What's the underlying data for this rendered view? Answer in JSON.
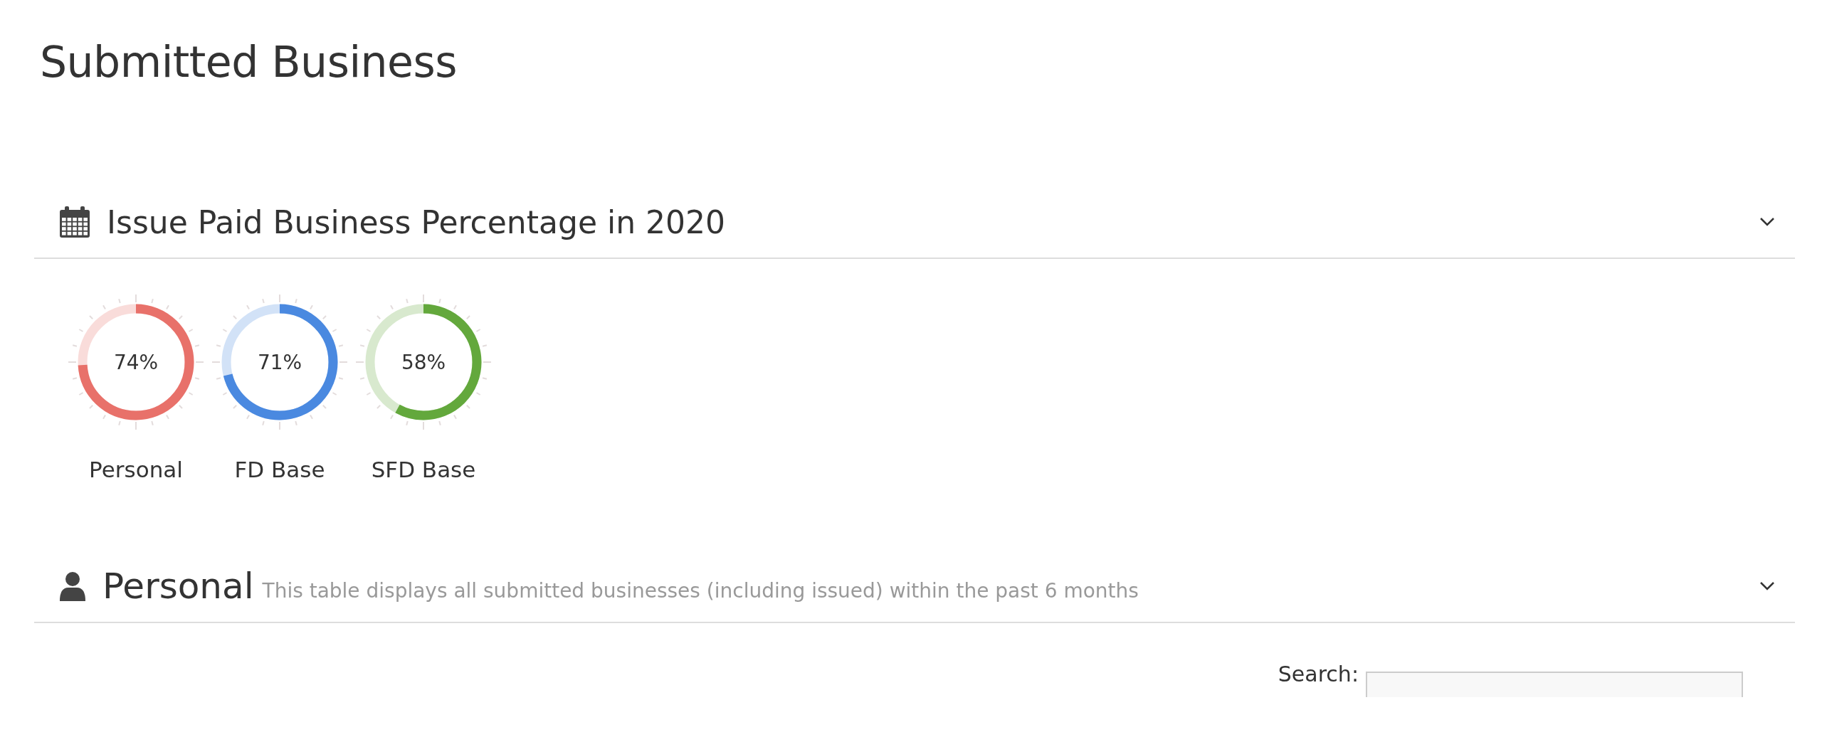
{
  "page_title": "Submitted Business",
  "sections": [
    {
      "kind": "gauges",
      "title": "Issue Paid Business Percentage in 2020",
      "expanded": true,
      "gauges": [
        {
          "label": "Personal",
          "reading": "74%",
          "level": 0.74,
          "color": "#e8716a"
        },
        {
          "label": "FD Base",
          "reading": "71%",
          "level": 0.71,
          "color": "#4a89e0"
        },
        {
          "label": "SFD Base",
          "reading": "58%",
          "level": 0.58,
          "color": "#63a83c"
        }
      ]
    },
    {
      "kind": "table",
      "title": "Personal",
      "subtitle": "This table displays all submitted businesses (including issued) within the past 6 months",
      "expanded": true,
      "search": {
        "label": "Search:"
      }
    }
  ]
}
